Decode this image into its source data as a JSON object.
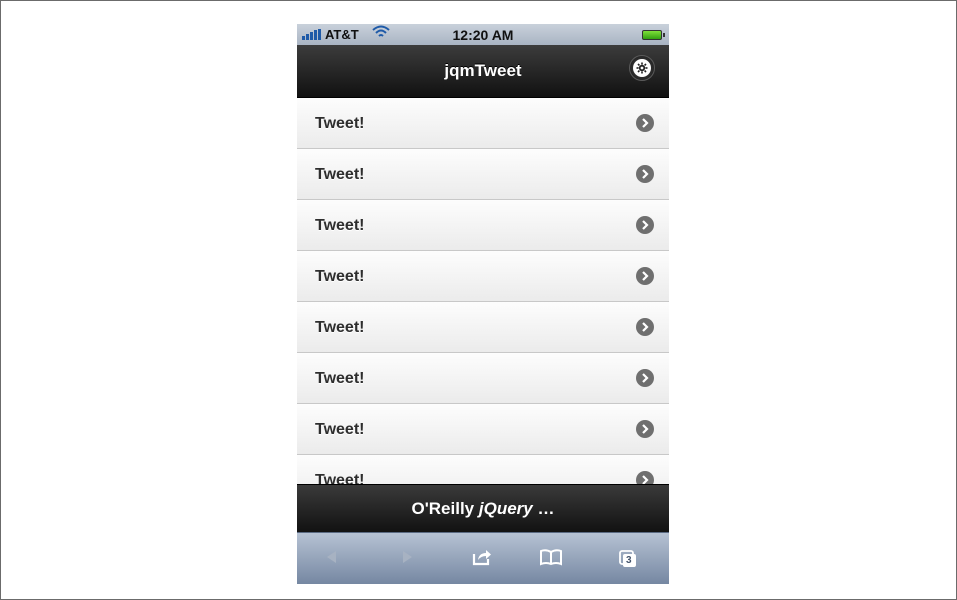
{
  "status_bar": {
    "carrier": "AT&T",
    "time": "12:20 AM",
    "signal_icon": "signal-bars-icon",
    "wifi_icon": "wifi-icon",
    "battery_icon": "battery-icon"
  },
  "header": {
    "title": "jqmTweet",
    "settings_icon": "gear-icon"
  },
  "list": {
    "items": [
      {
        "label": "Tweet!"
      },
      {
        "label": "Tweet!"
      },
      {
        "label": "Tweet!"
      },
      {
        "label": "Tweet!"
      },
      {
        "label": "Tweet!"
      },
      {
        "label": "Tweet!"
      },
      {
        "label": "Tweet!"
      },
      {
        "label": "Tweet!"
      }
    ],
    "item_icon": "chevron-right-icon"
  },
  "footer": {
    "title_prefix": "O'Reilly ",
    "title_emphasis": "jQuery",
    "title_suffix": " …"
  },
  "toolbar": {
    "back_icon": "back-arrow-icon",
    "forward_icon": "forward-arrow-icon",
    "share_icon": "share-icon",
    "bookmarks_icon": "bookmarks-icon",
    "tabs_icon": "tabs-icon",
    "tabs_count": "3"
  },
  "colors": {
    "header_bg": "#1c1c1c",
    "list_bg": "#f3f3f3",
    "chevron": "#6f6f6f",
    "toolbar_bg": "#8e9db3"
  }
}
